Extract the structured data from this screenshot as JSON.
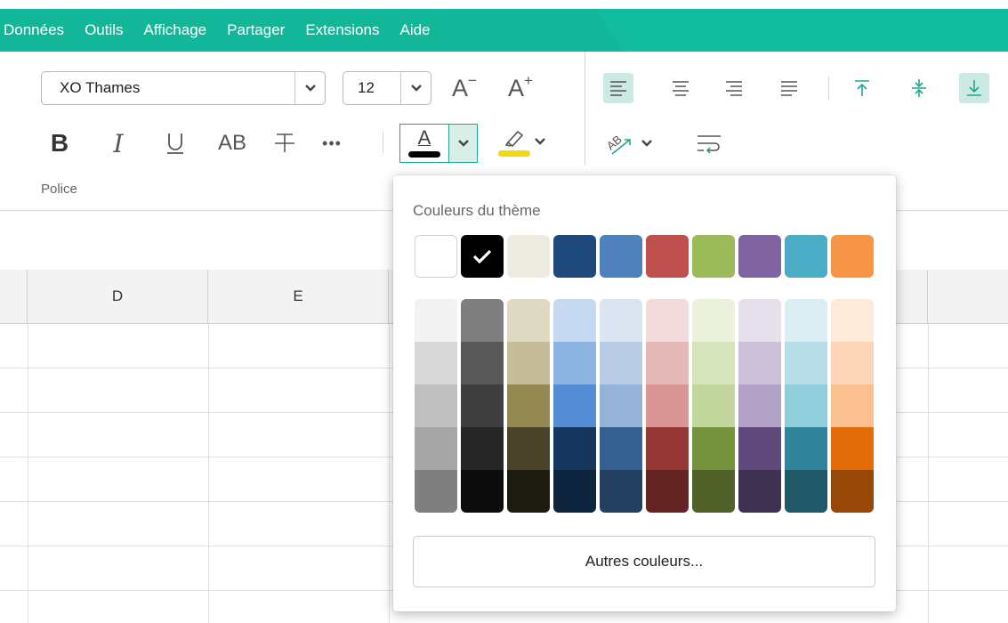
{
  "menu": {
    "items": [
      "Données",
      "Outils",
      "Affichage",
      "Partager",
      "Extensions",
      "Aide"
    ]
  },
  "toolbar": {
    "font_name": "XO Thames",
    "font_size": "12",
    "caps_label": "AB",
    "more_label": "•••",
    "group_label": "Police",
    "text_color": "#000000",
    "highlight_color": "#f5d90a",
    "active_align": "bottom"
  },
  "colors": {
    "accent": "#11bd9e",
    "menubar_text": "#ffffff"
  },
  "grid": {
    "column_headers": [
      "D",
      "E"
    ]
  },
  "color_popup": {
    "title": "Couleurs du thème",
    "selected": "#000000",
    "theme_colors": [
      "#ffffff",
      "#000000",
      "#eeece1",
      "#1f497d",
      "#4f81bd",
      "#c0504d",
      "#9bbb59",
      "#8064a2",
      "#4bacc6",
      "#f79646"
    ],
    "shades": [
      [
        "#f2f2f2",
        "#d8d8d8",
        "#bfbfbf",
        "#a5a5a5",
        "#7f7f7f"
      ],
      [
        "#7f7f7f",
        "#595959",
        "#3f3f3f",
        "#262626",
        "#0c0c0c"
      ],
      [
        "#ddd9c3",
        "#c4bd97",
        "#938953",
        "#494429",
        "#1d1b10"
      ],
      [
        "#c6d9f0",
        "#8db3e2",
        "#548dd4",
        "#17365d",
        "#0f243e"
      ],
      [
        "#dbe5f1",
        "#b8cce4",
        "#95b3d7",
        "#366092",
        "#244061"
      ],
      [
        "#f2dcdb",
        "#e5b9b7",
        "#d99694",
        "#953734",
        "#632423"
      ],
      [
        "#ebf1dd",
        "#d7e3bc",
        "#c3d69b",
        "#76923c",
        "#4f6128"
      ],
      [
        "#e5e0ec",
        "#ccc1d9",
        "#b2a2c7",
        "#5f497a",
        "#3f3151"
      ],
      [
        "#dbeef3",
        "#b7dde8",
        "#92cddc",
        "#31859b",
        "#205867"
      ],
      [
        "#fdeada",
        "#fbd5b5",
        "#fac08f",
        "#e36c09",
        "#974806"
      ]
    ],
    "more_colors_label": "Autres couleurs..."
  }
}
